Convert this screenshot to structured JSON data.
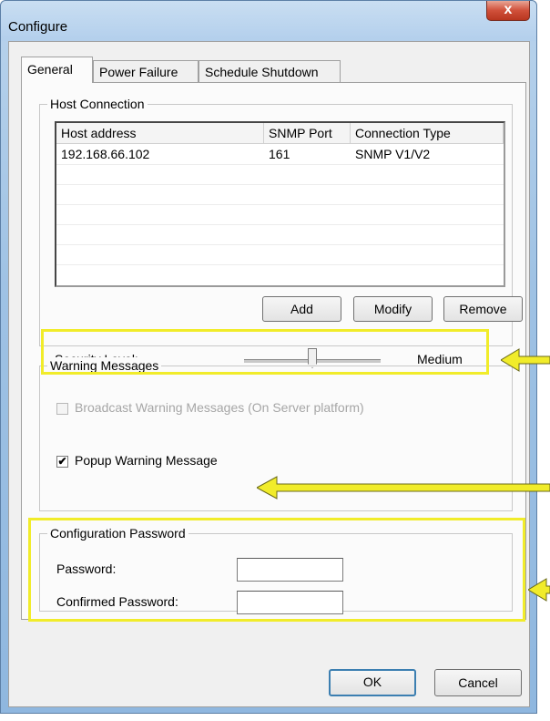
{
  "window": {
    "title": "Configure",
    "close_symbol": "x"
  },
  "tabs": [
    {
      "label": "General",
      "active": true
    },
    {
      "label": "Power Failure",
      "active": false
    },
    {
      "label": "Schedule Shutdown",
      "active": false
    }
  ],
  "host_connection": {
    "group_label": "Host Connection",
    "columns": [
      "Host address",
      "SNMP Port",
      "Connection Type"
    ],
    "rows": [
      {
        "host": "192.168.66.102",
        "port": "161",
        "type": "SNMP V1/V2"
      }
    ],
    "buttons": {
      "add": "Add",
      "modify": "Modify",
      "remove": "Remove"
    }
  },
  "security": {
    "label": "Security Level:",
    "value_text": "Medium",
    "level": 0.5
  },
  "warning_messages": {
    "group_label": "Warning Messages",
    "broadcast": {
      "label": "Broadcast Warning Messages (On Server platform)",
      "checked": false,
      "enabled": false
    },
    "popup": {
      "label": "Popup Warning Message",
      "checked": true,
      "enabled": true
    }
  },
  "config_password": {
    "group_label": "Configuration Password",
    "password_label": "Password:",
    "password_value": "",
    "confirm_label": "Confirmed Password:",
    "confirm_value": ""
  },
  "footer": {
    "ok": "OK",
    "cancel": "Cancel"
  },
  "colors": {
    "highlight": "#f1ec2a",
    "arrow": "#f1ec2a"
  }
}
